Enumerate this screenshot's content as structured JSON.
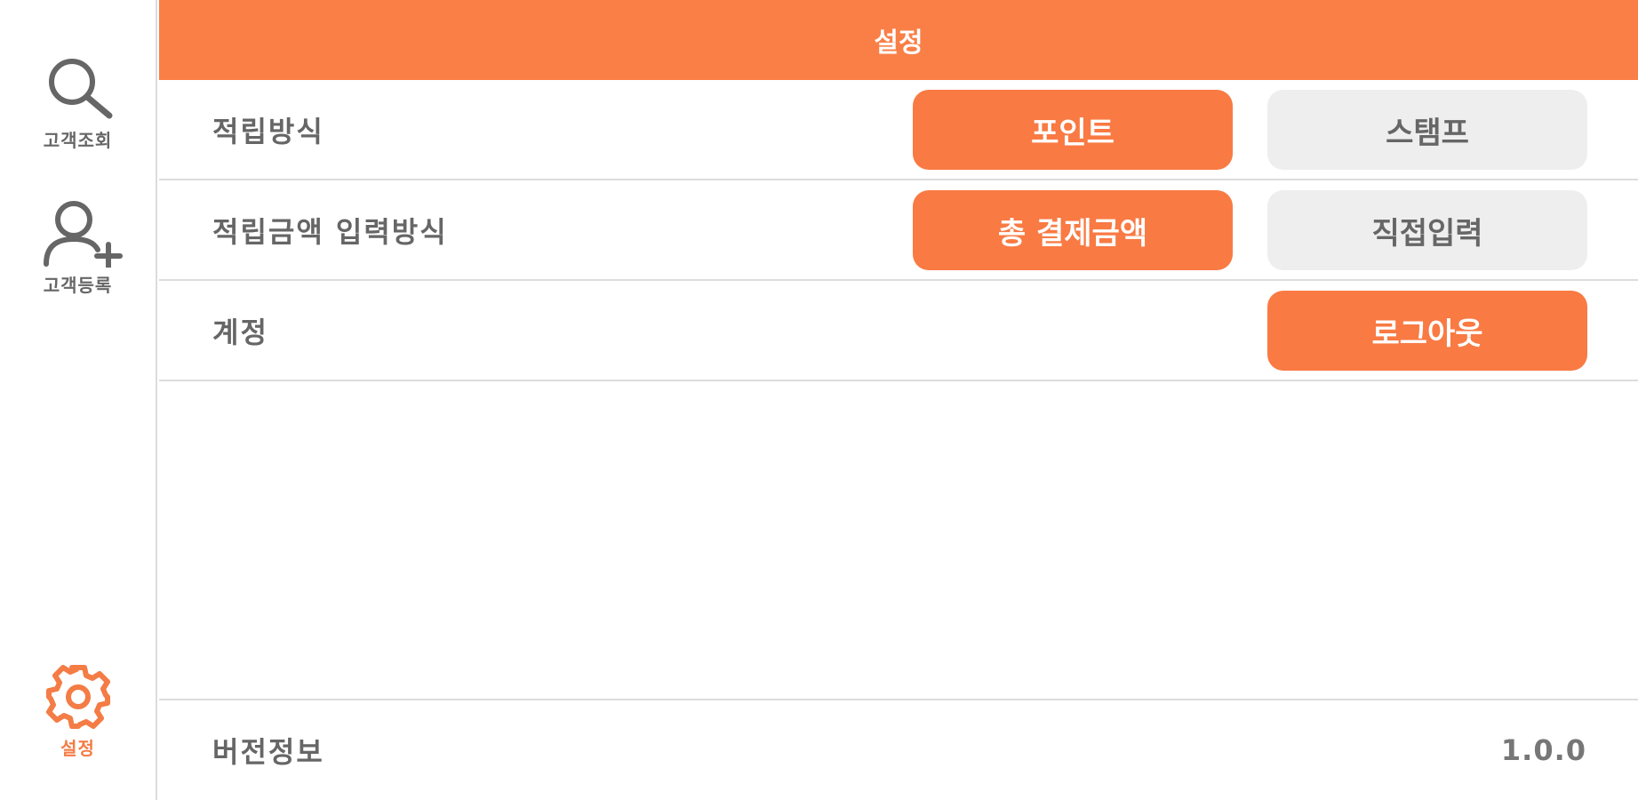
{
  "colors": {
    "accent": "#f97f47",
    "button_inactive": "#eeeeee",
    "text": "#666666"
  },
  "sidebar": {
    "items": [
      {
        "label": "고객조회",
        "icon": "search-icon"
      },
      {
        "label": "고객등록",
        "icon": "add-user-icon"
      },
      {
        "label": "설정",
        "icon": "gear-icon",
        "active": true
      }
    ]
  },
  "header": {
    "title": "설정"
  },
  "settings": {
    "rows": [
      {
        "label": "적립방식",
        "options": [
          "포인트",
          "스탬프"
        ],
        "selected": "포인트"
      },
      {
        "label": "적립금액 입력방식",
        "options": [
          "총 결제금액",
          "직접입력"
        ],
        "selected": "총 결제금액"
      },
      {
        "label": "계정",
        "action": "로그아웃"
      }
    ]
  },
  "footer": {
    "label": "버전정보",
    "value": "1.0.0"
  }
}
